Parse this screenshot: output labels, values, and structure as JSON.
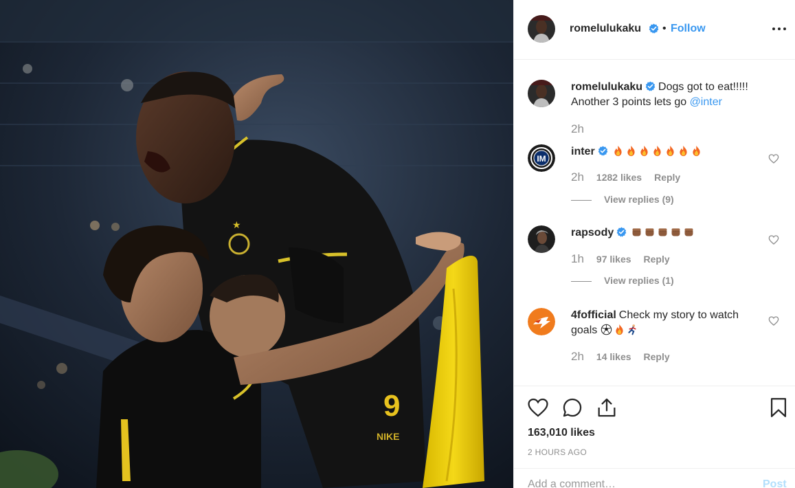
{
  "post": {
    "author": "romelulukaku",
    "follow_label": "Follow",
    "separator": "•",
    "caption": {
      "username": "romelulukaku",
      "text": "Dogs got to eat!!!!! Another 3 points lets go ",
      "mention": "@inter",
      "time": "2h"
    },
    "photo": {
      "shirt_numbers": [
        "9"
      ],
      "sponsor_mark": "NIKE"
    }
  },
  "comments": [
    {
      "username": "inter",
      "verified": true,
      "emoji": [
        "fire",
        "fire",
        "fire",
        "fire",
        "fire",
        "fire",
        "fire"
      ],
      "time": "2h",
      "likes": "1282 likes",
      "reply_label": "Reply",
      "view_replies": "View replies (9)"
    },
    {
      "username": "rapsody",
      "verified": true,
      "emoji": [
        "fist",
        "fist",
        "fist",
        "fist",
        "fist"
      ],
      "time": "1h",
      "likes": "97 likes",
      "reply_label": "Reply",
      "view_replies": "View replies (1)"
    },
    {
      "username": "4fofficial",
      "verified": false,
      "text": "Check my story to watch goals ",
      "emoji": [
        "soccer-ball",
        "fire",
        "runner"
      ],
      "time": "2h",
      "likes": "14 likes",
      "reply_label": "Reply"
    }
  ],
  "footer": {
    "likes": "163,010 likes",
    "timestamp": "2 HOURS AGO",
    "add_comment_placeholder": "Add a comment…",
    "post_label": "Post"
  },
  "colors": {
    "link_blue": "#3897f0",
    "verified_blue": "#3897f0",
    "secondary_text": "#8e8e8e",
    "primary_text": "#262626",
    "inter_yellow": "#f2d51b"
  },
  "icons": {
    "more": "ellipsis-icon",
    "like": "heart-icon",
    "comment": "comment-bubble-icon",
    "share": "share-icon",
    "save": "bookmark-icon"
  }
}
